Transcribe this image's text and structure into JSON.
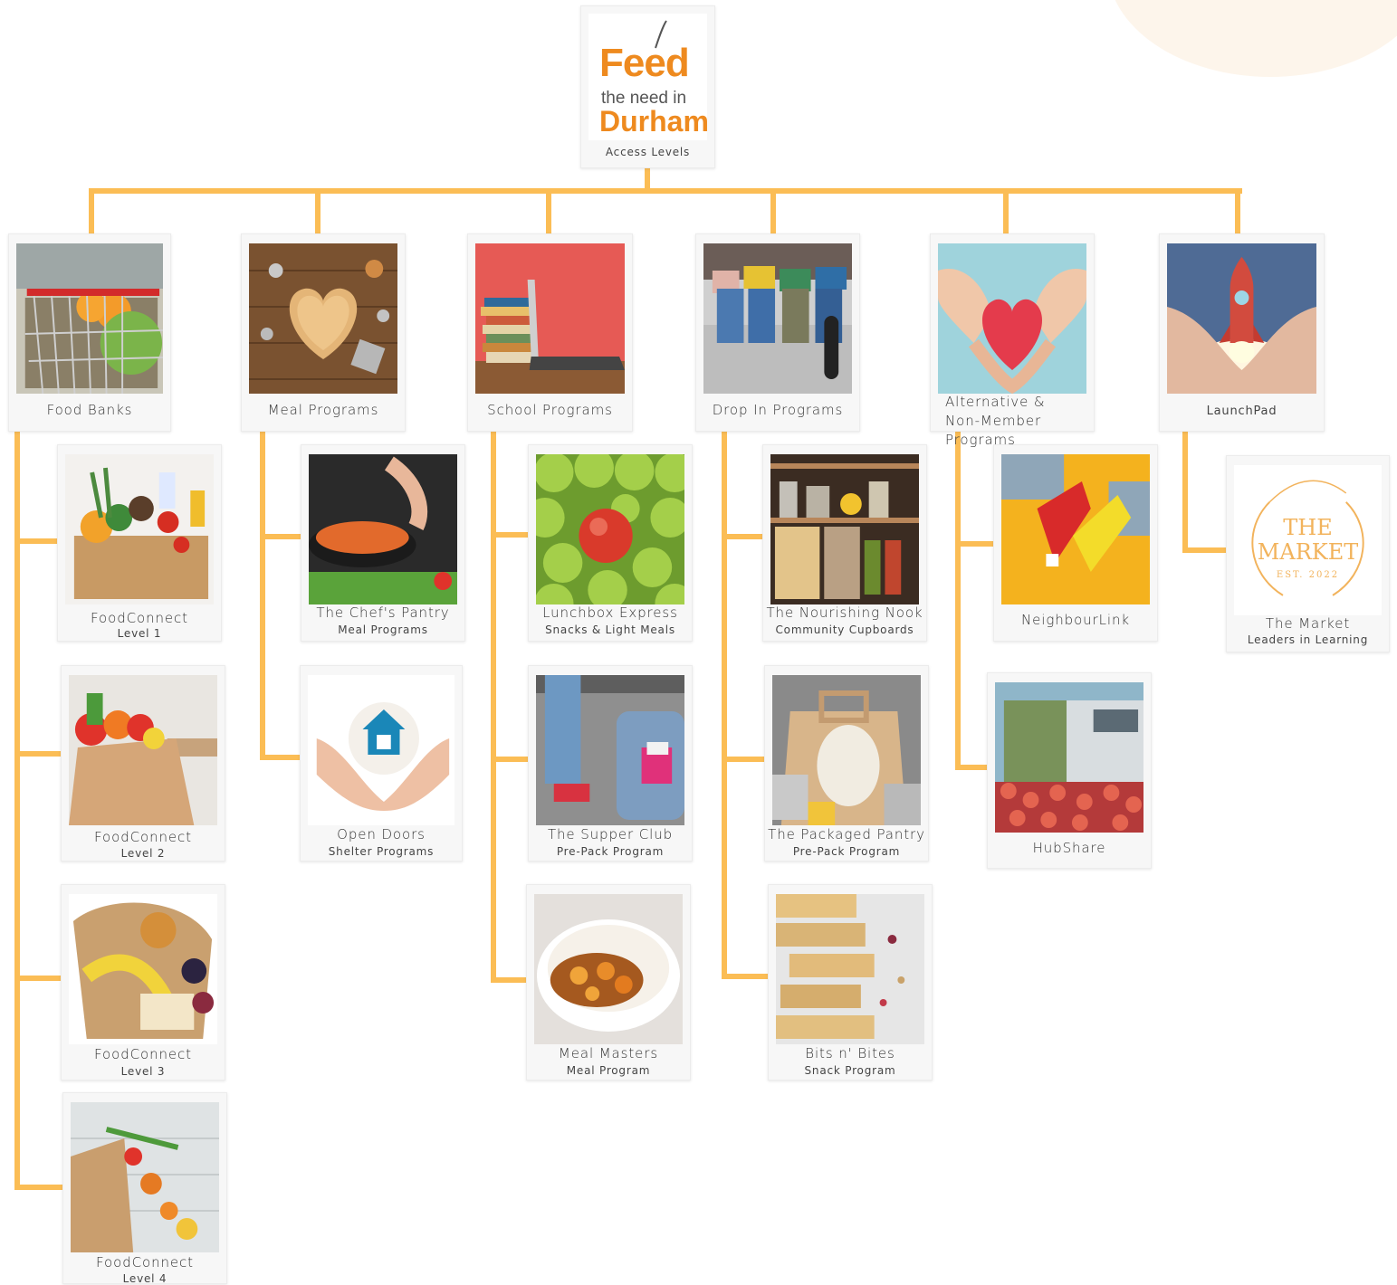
{
  "logo": {
    "line1": "Feed",
    "line2": "the need in",
    "line3": "Durham",
    "caption": "Access Levels"
  },
  "colors": {
    "connector": "#fbbd55",
    "logo_orange": "#ee8a1f",
    "market_gold": "#f2b35c"
  },
  "categories": [
    {
      "label": "Food Banks",
      "icon": "shopping-cart-photo"
    },
    {
      "label": "Meal Programs",
      "icon": "kitchen-utensils-heart-photo"
    },
    {
      "label": "School Programs",
      "icon": "books-laptop-photo"
    },
    {
      "label": "Drop In Programs",
      "icon": "students-sitting-photo"
    },
    {
      "label": "Alternative & Non-Member Programs",
      "icon": "hands-heart-photo"
    },
    {
      "label": "LaunchPad",
      "icon": "hands-rocket-photo"
    }
  ],
  "food_banks": [
    {
      "title": "FoodConnect",
      "sub": "Level 1"
    },
    {
      "title": "FoodConnect",
      "sub": "Level 2"
    },
    {
      "title": "FoodConnect",
      "sub": "Level 3"
    },
    {
      "title": "FoodConnect",
      "sub": "Level 4"
    }
  ],
  "meal_programs": [
    {
      "title": "The Chef's Pantry",
      "sub": "Meal Programs"
    },
    {
      "title": "Open Doors",
      "sub": "Shelter Programs"
    }
  ],
  "school_programs": [
    {
      "title": "Lunchbox Express",
      "sub": "Snacks & Light Meals"
    },
    {
      "title": "The Supper Club",
      "sub": "Pre-Pack Program"
    },
    {
      "title": "Meal Masters",
      "sub": "Meal Program"
    }
  ],
  "drop_in_programs": [
    {
      "title": "The Nourishing Nook",
      "sub": "Community Cupboards"
    },
    {
      "title": "The Packaged Pantry",
      "sub": "Pre-Pack Program"
    },
    {
      "title": "Bits n' Bites",
      "sub": "Snack Program"
    }
  ],
  "alternative_programs": [
    {
      "title": "NeighbourLink"
    },
    {
      "title": "HubShare"
    }
  ],
  "launchpad": [
    {
      "title": "The Market",
      "sub": "Leaders in Learning",
      "logo_line1": "THE",
      "logo_line2": "MARKET",
      "logo_est": "EST. 2022"
    }
  ]
}
